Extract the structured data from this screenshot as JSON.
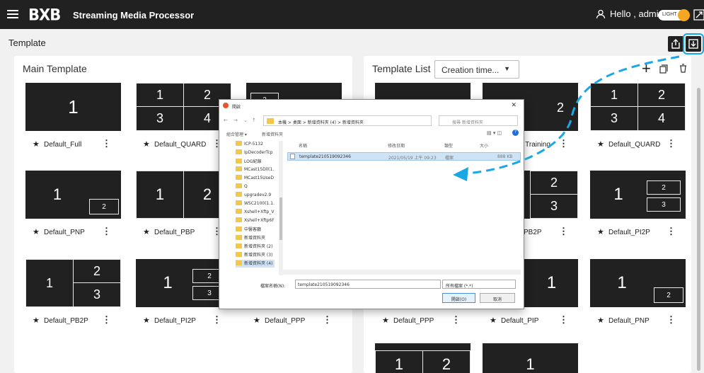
{
  "header": {
    "logo": "BXB",
    "app_title": "Streaming Media Processor",
    "greeting": "Hello , admin",
    "theme_label": "LIGHT"
  },
  "page": {
    "title": "Template"
  },
  "main_template": {
    "title": "Main Template",
    "cards": [
      {
        "name": "Default_Full",
        "cells": [
          "1"
        ]
      },
      {
        "name": "Default_QUARD",
        "cells": [
          "1",
          "2",
          "3",
          "4"
        ]
      },
      {
        "name": "",
        "cells": [
          "2"
        ]
      },
      {
        "name": "Default_PNP",
        "cells": [
          "1",
          "2"
        ]
      },
      {
        "name": "Default_PBP",
        "cells": [
          "1",
          "2"
        ]
      },
      {
        "name": "Default_PB2P",
        "cells": [
          "1",
          "2",
          "3"
        ]
      },
      {
        "name": "Default_PI2P",
        "cells": [
          "1",
          "2",
          "3"
        ]
      },
      {
        "name": "Default_PPP",
        "cells": []
      }
    ]
  },
  "template_list": {
    "title": "Template List",
    "sort_value": "Creation time...",
    "cards": [
      {
        "name": "",
        "cells": []
      },
      {
        "name": "1 Training",
        "cells": [
          "2"
        ]
      },
      {
        "name": "Default_QUARD",
        "cells": [
          "1",
          "2",
          "3",
          "4"
        ]
      },
      {
        "name": "PB2P",
        "cells": [
          "2",
          "3"
        ]
      },
      {
        "name": "Default_PI2P",
        "cells": [
          "1",
          "2",
          "3"
        ]
      },
      {
        "name": "Default_PPP",
        "cells": []
      },
      {
        "name": "Default_PIP",
        "cells": [
          "1"
        ]
      },
      {
        "name": "Default_PNP",
        "cells": [
          "1",
          "2"
        ]
      },
      {
        "name": "",
        "cells": [
          "1",
          "2"
        ]
      },
      {
        "name": "",
        "cells": [
          "1"
        ]
      }
    ]
  },
  "dialog": {
    "title": "開啟",
    "path": "本機 > 桌面 > 新增資料夾 (4) > 新增資料夾",
    "search_placeholder": "搜尋 新增資料夾",
    "organize": "組合管理 ▾",
    "new_folder": "新增資料夾",
    "folders": [
      "ICP-5132",
      "IpDecoderTcp",
      "LOG紀錄",
      "MCast15Dll(1.",
      "MCast15UseD",
      "Q",
      "upgradev2.9",
      "WSC2100(1.1.",
      "Xshell+Xftp_V",
      "Xshell+Xftp6F",
      "中醫客廳",
      "新增資料夾",
      "新增資料夾 (2)",
      "新增資料夾 (3)",
      "新增資料夾 (4)"
    ],
    "columns": {
      "name": "名稱",
      "date": "修改日期",
      "type": "類型",
      "size": "大小"
    },
    "file": {
      "name": "template210519092346",
      "date": "2021/05/19 上午 09:23",
      "type": "檔案",
      "size": "888 KB"
    },
    "filename_label": "檔案名稱(N):",
    "filename_value": "template210519092346",
    "filetype_value": "所有檔案 (*.*)",
    "open_label": "開啟(O)",
    "cancel_label": "取消"
  },
  "colors": {
    "accent": "#1aa7e6",
    "tile": "#212121",
    "header": "#212121",
    "toggle": "#f5a623"
  }
}
